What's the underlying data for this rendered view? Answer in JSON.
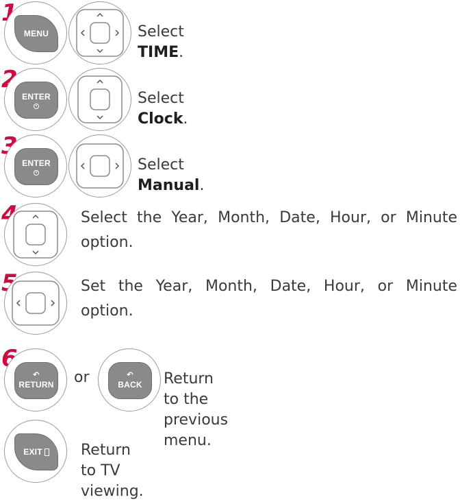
{
  "steps": [
    {
      "num": "1",
      "pre": "Select ",
      "bold": "TIME",
      "post": "."
    },
    {
      "num": "2",
      "pre": "Select ",
      "bold": "Clock",
      "post": "."
    },
    {
      "num": "3",
      "pre": "Select ",
      "bold": "Manual",
      "post": "."
    },
    {
      "num": "4",
      "line1": "Select the Year, Month, Date, Hour, or Minute",
      "line2": "option."
    },
    {
      "num": "5",
      "line1": "Set the Year, Month, Date, Hour, or Minute",
      "line2": "option."
    },
    {
      "num": "6",
      "or": "or",
      "text": "Return to the previous menu."
    },
    {
      "text": "Return to TV viewing."
    }
  ],
  "keys": {
    "menu": "MENU",
    "enter": "ENTER",
    "return": "RETURN",
    "back": "BACK",
    "exit": "EXIT"
  },
  "colors": {
    "step_number": "#cf0a3f",
    "key_fill": "#8a8a8a"
  },
  "icons": [
    "nav-up-down-left-right-icon",
    "nav-up-down-icon",
    "nav-left-right-icon",
    "return-arrow-icon",
    "enter-dot-icon"
  ]
}
